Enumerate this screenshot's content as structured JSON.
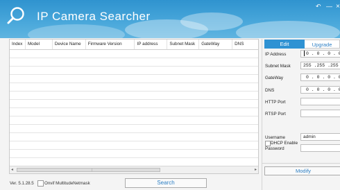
{
  "app": {
    "title": "IP Camera Searcher",
    "window_controls": {
      "back": "↶",
      "minimize": "—",
      "close": "×"
    }
  },
  "table": {
    "columns": [
      "Index",
      "Model",
      "Device Name",
      "Firmware Version",
      "IP address",
      "Subnet Mask",
      "GateWay",
      "DNS"
    ],
    "rows": []
  },
  "bottom": {
    "version": "Ver. 5.1.28.5",
    "onvif_label": "Onvif MultitudeNetmask",
    "onvif_checked": false,
    "search_label": "Search"
  },
  "panel": {
    "tabs": {
      "edit": "Edit",
      "upgrade": "Upgrade",
      "active": "Edit"
    },
    "fields": {
      "ip_address": {
        "label": "IP Address",
        "value": "0 . 0 . 0 . 0"
      },
      "subnet_mask": {
        "label": "Subnet Mask",
        "value": "255 .255 .255 . 0"
      },
      "gateway": {
        "label": "GateWay",
        "value": "0 . 0 . 0 . 0"
      },
      "dns": {
        "label": "DNS",
        "value": "0 . 0 . 0 . 0"
      },
      "http_port": {
        "label": "HTTP Port",
        "value": ""
      },
      "rtsp_port": {
        "label": "RTSP Port",
        "value": ""
      },
      "username": {
        "label": "Username",
        "value": "admin"
      },
      "password": {
        "label": "Password",
        "value": ""
      }
    },
    "dhcp_label": "DHCP Enable",
    "dhcp_checked": false,
    "modify_label": "Modify"
  },
  "colors": {
    "header_blue": "#2f93cf",
    "accent_blue": "#2d7fc4",
    "tab_active": "#2f92d3"
  }
}
